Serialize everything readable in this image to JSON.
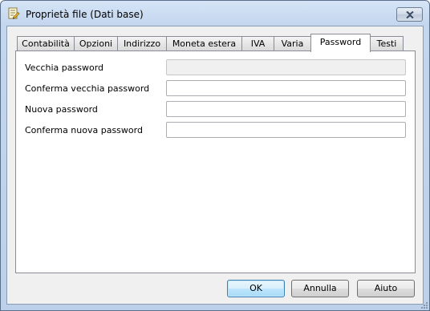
{
  "window": {
    "title": "Proprietà file (Dati base)",
    "icon": "file-properties-icon"
  },
  "tabs": [
    {
      "label": "Contabilità",
      "selected": false
    },
    {
      "label": "Opzioni",
      "selected": false
    },
    {
      "label": "Indirizzo",
      "selected": false
    },
    {
      "label": "Moneta estera",
      "selected": false
    },
    {
      "label": "IVA",
      "selected": false
    },
    {
      "label": "Varia",
      "selected": false
    },
    {
      "label": "Password",
      "selected": true
    },
    {
      "label": "Testi",
      "selected": false
    }
  ],
  "password_tab": {
    "fields": [
      {
        "label": "Vecchia password",
        "value": "",
        "enabled": false
      },
      {
        "label": "Conferma vecchia password",
        "value": "",
        "enabled": true
      },
      {
        "label": "Nuova password",
        "value": "",
        "enabled": true
      },
      {
        "label": "Conferma nuova password",
        "value": "",
        "enabled": true
      }
    ]
  },
  "buttons": {
    "ok": "OK",
    "cancel": "Annulla",
    "help": "Aiuto"
  },
  "colors": {
    "titlebar": "#c3d6ee",
    "dialog_bg": "#f0f0f0",
    "default_button_border": "#3c7fb1"
  }
}
